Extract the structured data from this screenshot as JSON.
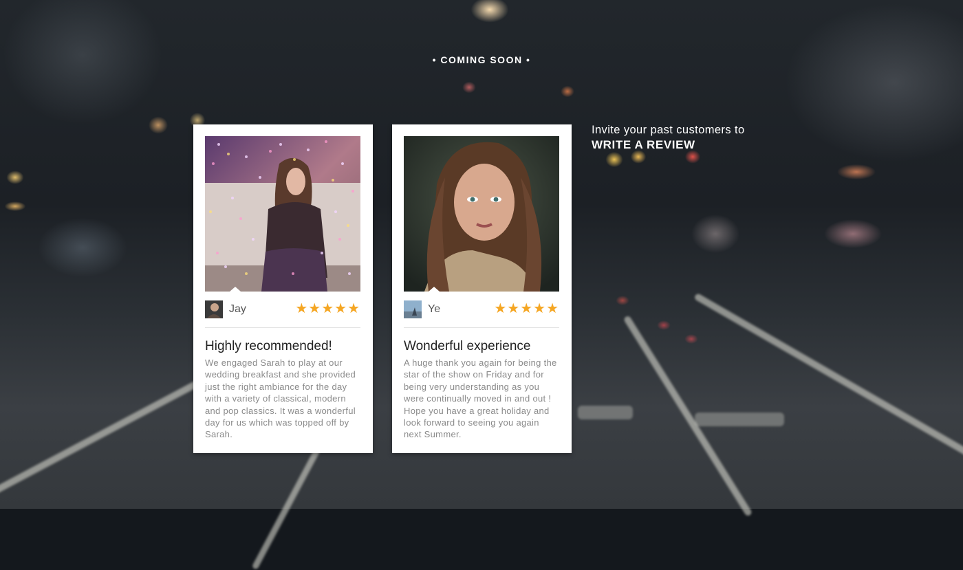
{
  "headline": "• COMING SOON •",
  "invite": {
    "line1": "Invite your past customers to",
    "line2": "WRITE A REVIEW"
  },
  "reviews": [
    {
      "name": "Jay",
      "rating": 5,
      "stars": "★★★★★",
      "title": "Highly recommended!",
      "body": "We engaged Sarah to play at our wedding breakfast and she provided just the right ambiance for the day with a variety of classical, modern and pop classics. It was a wonderful day for us which was topped off by Sarah."
    },
    {
      "name": "Ye",
      "rating": 5,
      "stars": "★★★★★",
      "title": "Wonderful experience",
      "body": "A huge thank you again for being the star of the show on Friday and for being very understanding as you were continually moved in and out ! Hope you have a great holiday and look forward to seeing you again next Summer."
    }
  ],
  "colors": {
    "star": "#f5a623",
    "card_bg": "#ffffff",
    "body_text": "#8a8a8a"
  }
}
